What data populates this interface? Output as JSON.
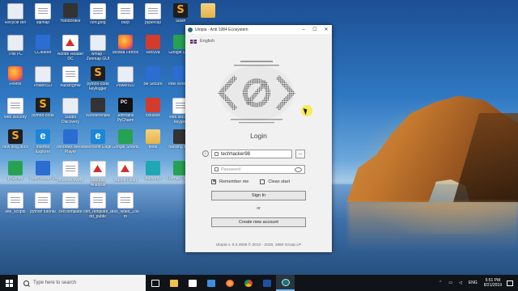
{
  "desktop": {
    "icons": [
      {
        "label": "Recycle Bin",
        "kind": "i-app"
      },
      {
        "label": "sqlmap",
        "kind": "i-doc"
      },
      {
        "label": "HandBrake",
        "kind": "i-dark"
      },
      {
        "label": "cert.jpeg",
        "kind": "i-doc"
      },
      {
        "label": "burp",
        "kind": "i-doc"
      },
      {
        "label": "pyperclip",
        "kind": "i-doc"
      },
      {
        "label": "Slash",
        "kind": "i-slash"
      },
      {
        "label": "",
        "kind": "i-folder"
      },
      {
        "label": "This PC",
        "kind": "i-app"
      },
      {
        "label": "CCleaner",
        "kind": "i-blue"
      },
      {
        "label": "Adobe Reader DC",
        "kind": "i-pdf"
      },
      {
        "label": "Nmap - Zenmap GUI",
        "kind": "i-app"
      },
      {
        "label": "Mozilla Firefox",
        "kind": "i-firefox"
      },
      {
        "label": "Recuva",
        "kind": "i-red"
      },
      {
        "label": "Google Drive",
        "kind": "i-green"
      },
      {
        "label": "Malwarebytes",
        "kind": "i-malware"
      },
      {
        "label": "Firefox",
        "kind": "i-firefox"
      },
      {
        "label": "PowerISO",
        "kind": "i-app"
      },
      {
        "label": "hackingmw",
        "kind": "i-doc"
      },
      {
        "label": "python-code keylogger",
        "kind": "i-slash"
      },
      {
        "label": "PowerISO",
        "kind": "i-app"
      },
      {
        "label": "Be Secure",
        "kind": "i-blue"
      },
      {
        "label": "Intel Wireless",
        "kind": "i-blue"
      },
      {
        "label": "Picasa 3",
        "kind": "i-chrome"
      },
      {
        "label": "web security",
        "kind": "i-doc"
      },
      {
        "label": "python-code",
        "kind": "i-slash"
      },
      {
        "label": "Studio Discovery",
        "kind": "i-app"
      },
      {
        "label": "Wondershare",
        "kind": "i-dark"
      },
      {
        "label": "JetBrains PyCharm",
        "kind": "i-pycharm"
      },
      {
        "label": "cxfusion",
        "kind": "i-red"
      },
      {
        "label": "web security keygen",
        "kind": "i-doc"
      },
      {
        "label": "videos",
        "kind": "i-doc"
      },
      {
        "label": "new slog.docx",
        "kind": "i-slash"
      },
      {
        "label": "Internet Explorer",
        "kind": "i-ie"
      },
      {
        "label": "Windows Media Player",
        "kind": "i-blue"
      },
      {
        "label": "Microsoft Edge",
        "kind": "i-ie"
      },
      {
        "label": "Google Sheets",
        "kind": "i-green"
      },
      {
        "label": "texts",
        "kind": "i-folder"
      },
      {
        "label": "hacking tools",
        "kind": "i-dark"
      },
      {
        "label": "Google Chrome",
        "kind": "i-chrome"
      },
      {
        "label": "pfSense",
        "kind": "i-green"
      },
      {
        "label": "TeamViewer 14",
        "kind": "i-blue"
      },
      {
        "label": "photorecovery",
        "kind": "i-doc"
      },
      {
        "label": "security Analysis",
        "kind": "i-pdf"
      },
      {
        "label": "Adobe Read",
        "kind": "i-pdf"
      },
      {
        "label": "Authority",
        "kind": "i-teal"
      },
      {
        "label": "Format Factory",
        "kind": "i-green"
      },
      {
        "label": "uploads.csv",
        "kind": "i-doc"
      },
      {
        "label": "site_scripts",
        "kind": "i-doc"
      },
      {
        "label": "python tutorial",
        "kind": "i-doc"
      },
      {
        "label": "cert.template",
        "kind": "i-doc"
      },
      {
        "label": "cert_template_add_public",
        "kind": "i-doc"
      },
      {
        "label": "xss_video_Zoom",
        "kind": "i-doc"
      }
    ]
  },
  "window": {
    "title": "Utopia - Anti 1984 Ecosystem",
    "minimize": "–",
    "maximize": "☐",
    "close": "✕",
    "language": "English",
    "heading": "Login",
    "info_glyph": "i",
    "username_value": "techhacker98",
    "browse_label": "...",
    "password_placeholder": "Password",
    "remember_label": "Remember me",
    "remember_checked_glyph": "✕",
    "clean_start_label": "Clean start",
    "sign_in_label": "Sign In",
    "or_label": "or",
    "create_account_label": "Create new account",
    "footer": "Utopia v. 0.3.4936 © 2013 - 2019, 1984 Group LP"
  },
  "taskbar": {
    "search_placeholder": "Type here to search",
    "tray_language": "ENG",
    "time": "5:51 PM",
    "date": "8/21/2019"
  },
  "colors": {
    "taskbar_bg": "#101418",
    "window_bg": "#f1f1f1",
    "accent": "#76b9ed"
  }
}
